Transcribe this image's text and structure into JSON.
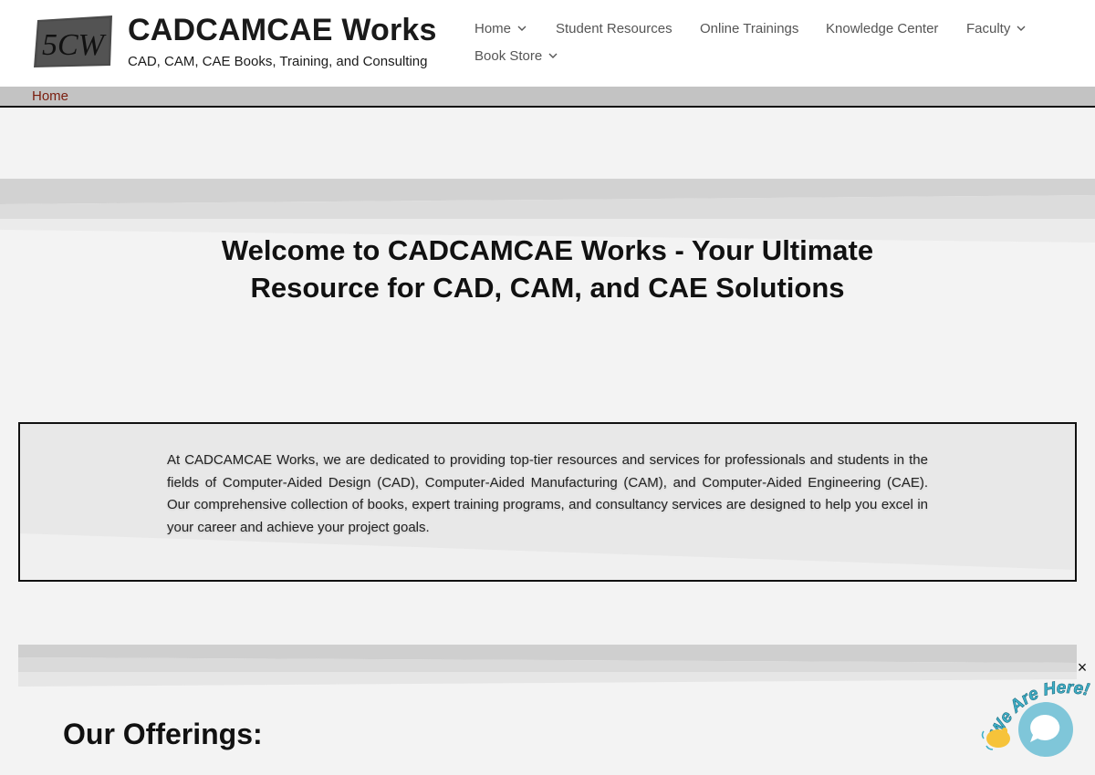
{
  "header": {
    "logo_text": "5CW",
    "title": "CADCAMCAE Works",
    "tagline": "CAD, CAM, CAE Books, Training, and Consulting"
  },
  "nav": {
    "items": [
      {
        "label": "Home",
        "dropdown": true
      },
      {
        "label": "Student Resources",
        "dropdown": false
      },
      {
        "label": "Online Trainings",
        "dropdown": false
      },
      {
        "label": "Knowledge Center",
        "dropdown": false
      },
      {
        "label": "Faculty",
        "dropdown": true
      },
      {
        "label": "Book Store",
        "dropdown": true
      }
    ]
  },
  "breadcrumb": {
    "home": "Home"
  },
  "hero": {
    "title_line1": "Welcome to CADCAMCAE Works - Your Ultimate",
    "title_line2": "Resource for CAD, CAM, and CAE Solutions"
  },
  "intro": {
    "text": "At CADCAMCAE Works, we are dedicated to providing top-tier resources and services for professionals and students in the fields of Computer-Aided Design (CAD), Computer-Aided Manufacturing (CAM), and Computer-Aided Engineering (CAE). Our comprehensive collection of books, expert training programs, and consultancy services are designed to help you excel in your career and achieve your project goals."
  },
  "offerings": {
    "title": "Our Offerings:"
  },
  "chat": {
    "badge_text": "We Are Here!",
    "close_label": "×",
    "badge_color": "#3fb0c9",
    "bubble_color": "#7fc6d9"
  },
  "colors": {
    "breadcrumb_link": "#7a1d0e",
    "nav_text": "#555555",
    "breadcrumb_bar": "#c3c3c3"
  }
}
